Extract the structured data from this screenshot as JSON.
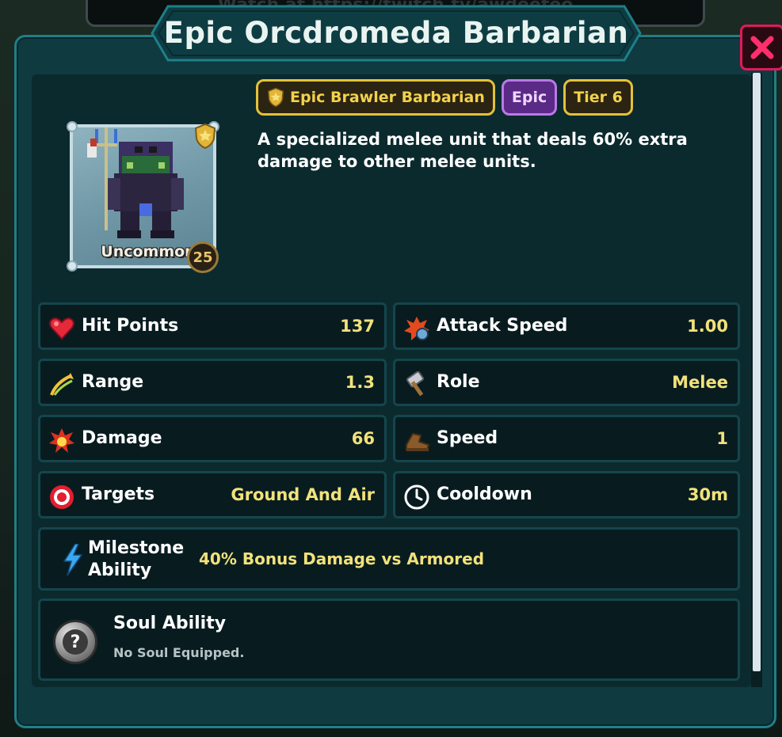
{
  "header": {
    "background_text": "Watch at https://twitch.tv/awdeeteo",
    "title": "Epic Orcdromeda Barbarian"
  },
  "unit": {
    "rarity": "Uncommon",
    "level": "25",
    "tags": {
      "class": "Epic Brawler Barbarian",
      "rarity": "Epic",
      "tier": "Tier 6"
    },
    "description": "A specialized melee unit that deals 60% extra damage to other melee units."
  },
  "stats": {
    "hit_points": {
      "label": "Hit Points",
      "value": "137"
    },
    "attack_speed": {
      "label": "Attack Speed",
      "value": "1.00"
    },
    "range": {
      "label": "Range",
      "value": "1.3"
    },
    "role": {
      "label": "Role",
      "value": "Melee"
    },
    "damage": {
      "label": "Damage",
      "value": "66"
    },
    "speed": {
      "label": "Speed",
      "value": "1"
    },
    "targets": {
      "label": "Targets",
      "value": "Ground And Air"
    },
    "cooldown": {
      "label": "Cooldown",
      "value": "30m"
    }
  },
  "milestone": {
    "label": "Milestone Ability",
    "value": "40% Bonus Damage vs Armored"
  },
  "soul": {
    "title": "Soul Ability",
    "subtitle": "No Soul Equipped.",
    "icon_glyph": "?"
  },
  "colors": {
    "panel_bg": "#0f3a40",
    "panel_border": "#1e7f87",
    "value_yellow": "#f2e27a",
    "close_red": "#e01a5a",
    "tag_gold": "#e2c23a",
    "tag_epic": "#b97ae6"
  },
  "icons": [
    "heart-icon",
    "attack-speed-icon",
    "range-icon",
    "role-hammer-icon",
    "damage-explosion-icon",
    "speed-boot-icon",
    "target-icon",
    "clock-icon",
    "lightning-icon",
    "question-icon",
    "close-icon",
    "shield-badge-icon"
  ]
}
